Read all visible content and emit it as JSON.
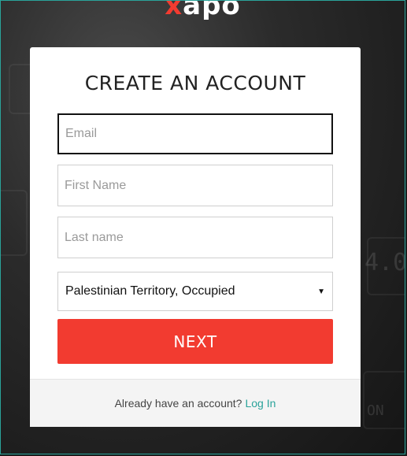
{
  "brand": {
    "logo_x": "x",
    "logo_rest": "apo"
  },
  "form": {
    "title": "CREATE AN ACCOUNT",
    "email_placeholder": "Email",
    "first_name_placeholder": "First Name",
    "last_name_placeholder": "Last name",
    "country_value": "Palestinian Territory, Occupied",
    "next_label": "NEXT"
  },
  "footer": {
    "prompt": "Already have an account?",
    "login_label": "Log In"
  },
  "background": {
    "key_text_1": "4.0",
    "key_text_2": "ON"
  },
  "colors": {
    "accent": "#f23b30",
    "link": "#2aa39a"
  }
}
